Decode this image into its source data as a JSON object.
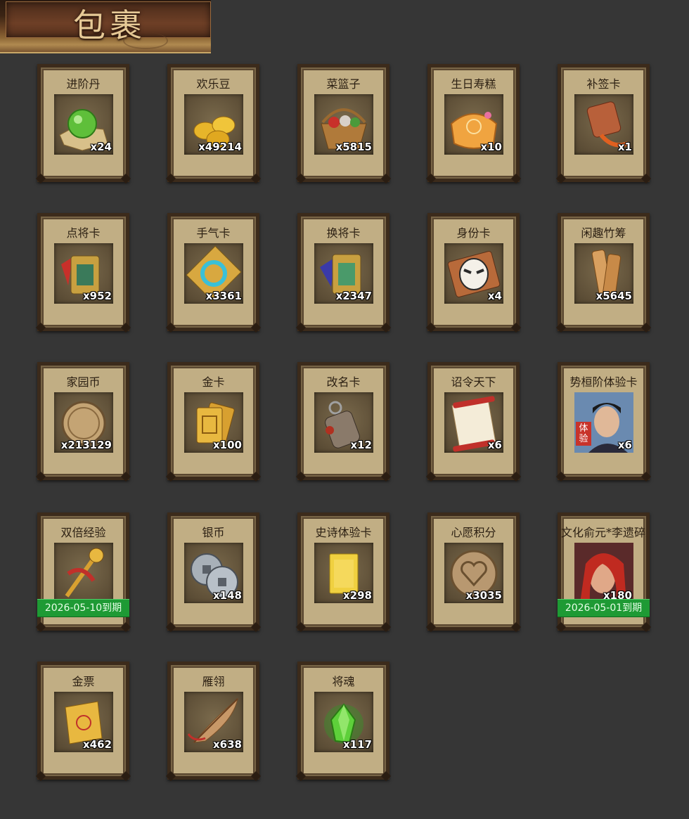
{
  "header": {
    "title": "包裹"
  },
  "items": [
    {
      "name": "进阶丹",
      "qty": "x24",
      "icon": "green-orb-icon"
    },
    {
      "name": "欢乐豆",
      "qty": "x49214",
      "icon": "gold-beans-icon"
    },
    {
      "name": "菜篮子",
      "qty": "x5815",
      "icon": "basket-icon"
    },
    {
      "name": "生日寿糕",
      "qty": "x10",
      "icon": "birthday-cake-icon"
    },
    {
      "name": "补签卡",
      "qty": "x1",
      "icon": "sign-card-icon"
    },
    {
      "name": "点将卡",
      "qty": "x952",
      "icon": "general-card-icon"
    },
    {
      "name": "手气卡",
      "qty": "x3361",
      "icon": "luck-card-icon"
    },
    {
      "name": "换将卡",
      "qty": "x2347",
      "icon": "swap-card-icon"
    },
    {
      "name": "身份卡",
      "qty": "x4",
      "icon": "identity-mask-icon"
    },
    {
      "name": "闲趣竹筹",
      "qty": "x5645",
      "icon": "bamboo-token-icon"
    },
    {
      "name": "家园币",
      "qty": "x213129",
      "icon": "home-coin-icon"
    },
    {
      "name": "金卡",
      "qty": "x100",
      "icon": "gold-card-icon"
    },
    {
      "name": "改名卡",
      "qty": "x12",
      "icon": "rename-tag-icon"
    },
    {
      "name": "诏令天下",
      "qty": "x6",
      "icon": "edict-scroll-icon"
    },
    {
      "name": "势桓阶体验卡",
      "qty": "x6",
      "icon": "hero-portrait-icon",
      "badge": "体验"
    },
    {
      "name": "双倍经验",
      "qty": "",
      "icon": "double-exp-scepter-icon",
      "expire": "2026-05-10到期"
    },
    {
      "name": "银币",
      "qty": "x148",
      "icon": "silver-coins-icon"
    },
    {
      "name": "史诗体验卡",
      "qty": "x298",
      "icon": "epic-card-icon"
    },
    {
      "name": "心愿积分",
      "qty": "x3035",
      "icon": "heart-coin-icon"
    },
    {
      "name": "文化俞元*李遗碎片",
      "qty": "x180",
      "icon": "hero-fragment-icon",
      "expire": "2026-05-01到期"
    },
    {
      "name": "金票",
      "qty": "x462",
      "icon": "gold-ticket-icon"
    },
    {
      "name": "雁翎",
      "qty": "x638",
      "icon": "feather-icon"
    },
    {
      "name": "将魂",
      "qty": "x117",
      "icon": "soul-crystal-icon"
    }
  ],
  "colors": {
    "background": "#363636",
    "card": "#c1ae84",
    "expire_green": "#1e9a34"
  }
}
